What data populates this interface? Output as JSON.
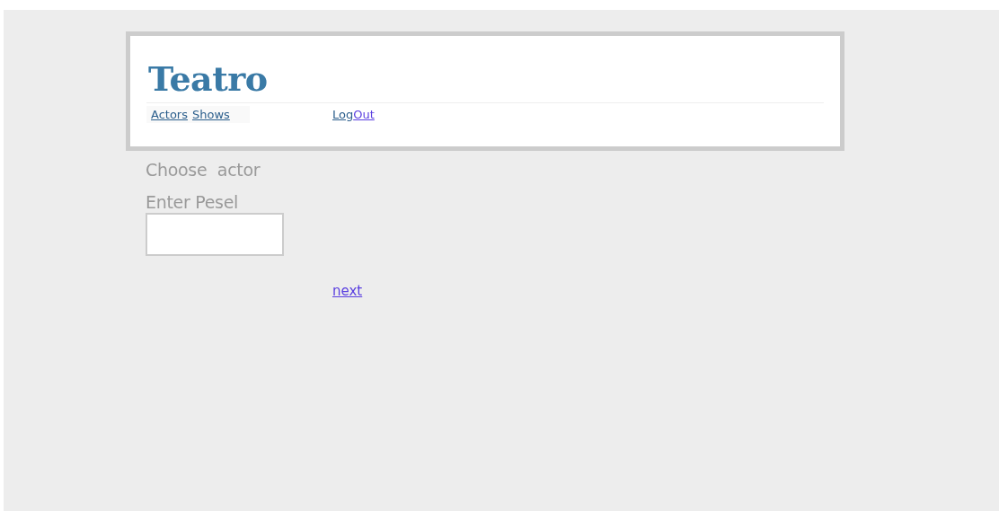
{
  "header": {
    "title": "Teatro",
    "nav": [
      {
        "label": "Actors",
        "visited": false
      },
      {
        "label": "Shows",
        "visited": false
      }
    ],
    "account": [
      {
        "label": "Log",
        "visited": false
      },
      {
        "label": "Out",
        "visited": true
      }
    ]
  },
  "form": {
    "heading": "Choose  actor",
    "field_label": "Enter Pesel",
    "next_link": "next"
  }
}
